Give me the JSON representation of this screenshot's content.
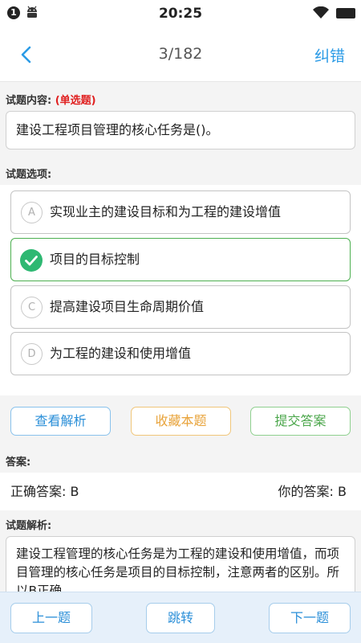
{
  "status_bar": {
    "badge": "1",
    "time": "20:25",
    "icons": [
      "notification-badge-icon",
      "android-icon",
      "wifi-icon",
      "battery-icon"
    ]
  },
  "nav": {
    "back_icon": "chevron-left-icon",
    "progress": "3/182",
    "correct_label": "纠错"
  },
  "question": {
    "label": "试题内容:",
    "type": "(单选题)",
    "text": "建设工程项目管理的核心任务是()。"
  },
  "options_label": "试题选项:",
  "options": [
    {
      "letter": "A",
      "text": "实现业主的建设目标和为工程的建设增值",
      "selected": false
    },
    {
      "letter": "B",
      "text": "项目的目标控制",
      "selected": true
    },
    {
      "letter": "C",
      "text": "提高建设项目生命周期价值",
      "selected": false
    },
    {
      "letter": "D",
      "text": "为工程的建设和使用增值",
      "selected": false
    }
  ],
  "actions": {
    "view_analysis": "查看解析",
    "favorite": "收藏本题",
    "submit": "提交答案"
  },
  "answer": {
    "label": "答案:",
    "correct": "正确答案: B",
    "yours": "你的答案: B"
  },
  "analysis": {
    "label": "试题解析:",
    "text": "建设工程管理的核心任务是为工程的建设和使用增值，而项目管理的核心任务是项目的目标控制，注意两者的区别。所以B正确。"
  },
  "bottom_nav": {
    "prev": "上一题",
    "jump": "跳转",
    "next": "下一题"
  },
  "colors": {
    "accent_blue": "#2b9be6",
    "selected_green": "#2eb872",
    "warning_orange": "#e8a33a",
    "error_red": "#e02020"
  }
}
